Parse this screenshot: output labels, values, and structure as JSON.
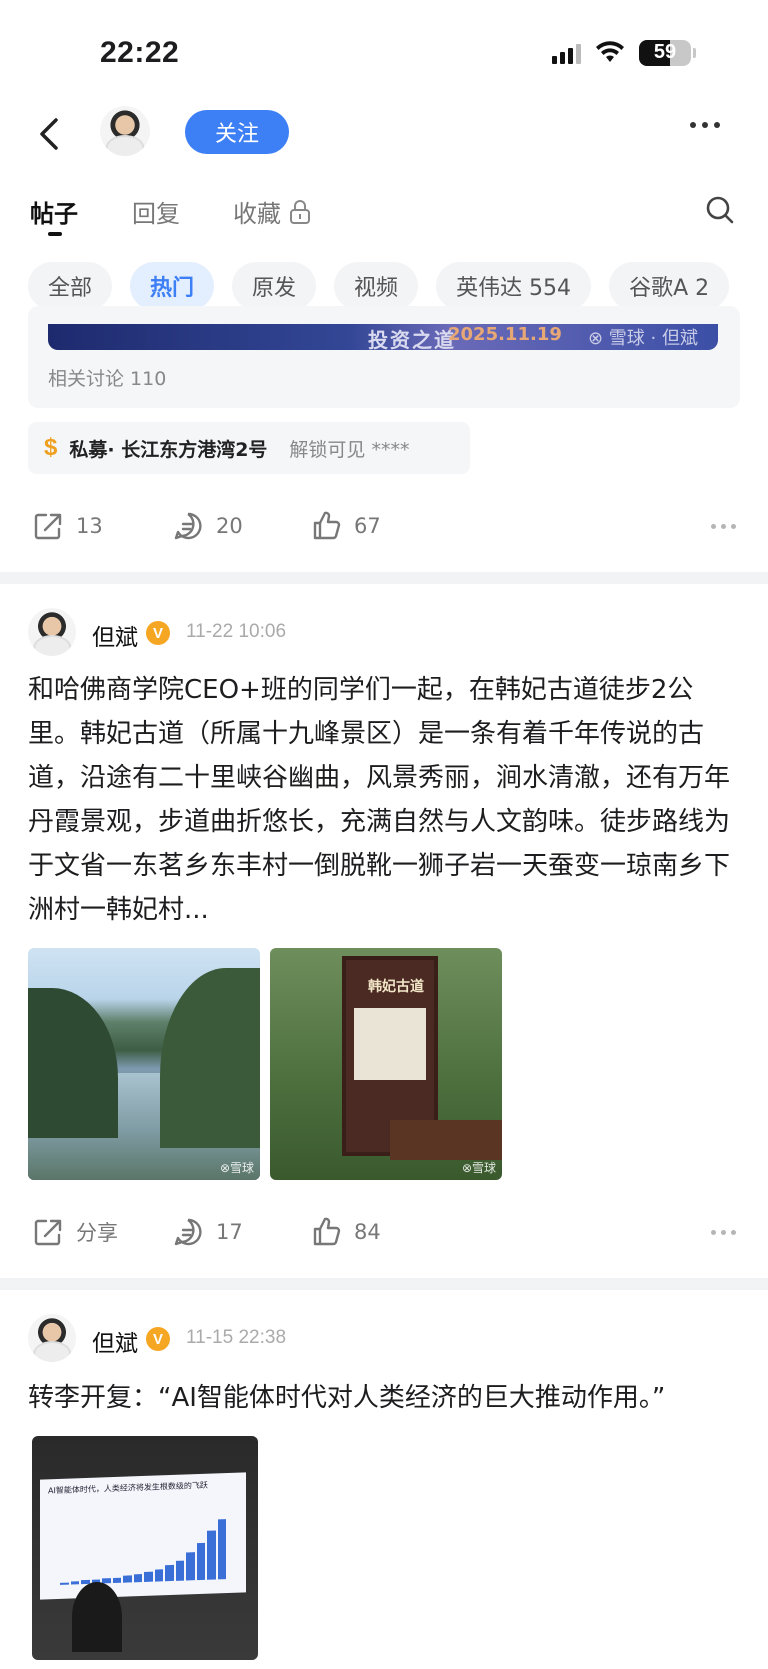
{
  "status_bar": {
    "time": "22:22",
    "battery": "59",
    "battery_level": 0.59
  },
  "nav": {
    "follow_label": "关注"
  },
  "main_tabs": [
    {
      "label": "帖子"
    },
    {
      "label": "回复"
    },
    {
      "label": "收藏"
    }
  ],
  "chips": [
    {
      "label": "全部"
    },
    {
      "label": "热门"
    },
    {
      "label": "原发"
    },
    {
      "label": "视频"
    },
    {
      "label": "英伟达 554"
    },
    {
      "label": "谷歌A 2"
    }
  ],
  "post1": {
    "banner_text_1": "投资之道",
    "banner_text_2": "2025.11.19",
    "banner_text_3": "⊗ 雪球 · 但斌",
    "related": "相关讨论 110",
    "fund_icon": "$",
    "fund_name": "私募· 长江东方港湾2号",
    "fund_lock": "解锁可见 ****",
    "share_count": "13",
    "comment_count": "20",
    "like_count": "67"
  },
  "post2": {
    "author": "但斌",
    "badge": "V",
    "time": "11-22 10:06",
    "text": "和哈佛商学院CEO+班的同学们一起，在韩妃古道徒步2公里。韩妃古道（所属十九峰景区）是一条有着千年传说的古道，沿途有二十里峡谷幽曲，风景秀丽，涧水清澈，还有万年丹霞景观，步道曲折悠长，充满自然与人文韵味。徒步路线为于文省一东茗乡东丰村一倒脱靴一狮子岩一天蚕变一琼南乡下洲村一韩妃村...",
    "image_sign_title": "韩妃古道",
    "watermark": "⊗雪球",
    "share_label": "分享",
    "comment_count": "17",
    "like_count": "84"
  },
  "post3": {
    "author": "但斌",
    "badge": "V",
    "time": "11-15 22:38",
    "text": "转李开复：“AI智能体时代对人类经济的巨大推动作用。”",
    "slide_title": "AI智能体时代，人类经济将发生根数级的飞跃"
  },
  "colors": {
    "accent": "#3d7ff5",
    "badge": "#f5a623",
    "fund_icon": "#f0a020"
  }
}
